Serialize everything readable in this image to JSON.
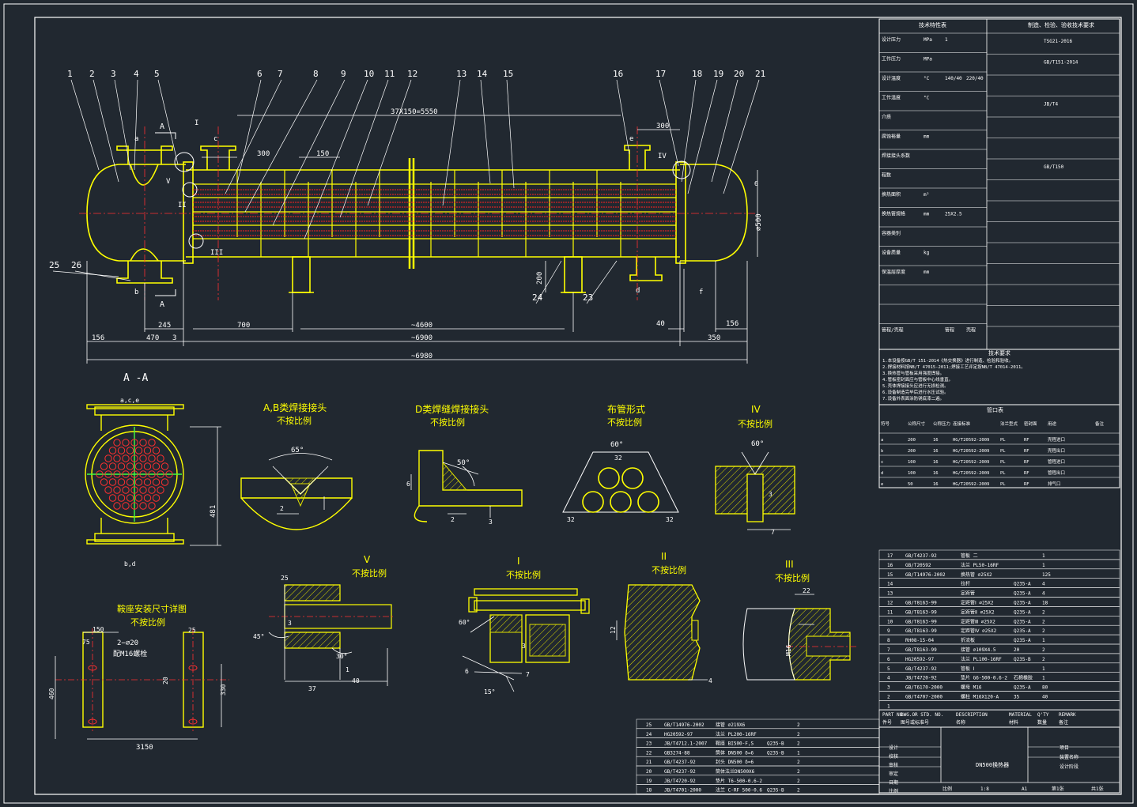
{
  "colors": {
    "background": "#212830",
    "frame": "#ffffff",
    "body": "#ffff00",
    "tube": "#ff2020",
    "hatch": "#e0e000",
    "center": "#ff3030",
    "text": "#ffffff"
  },
  "balloons": [
    "1",
    "2",
    "3",
    "4",
    "5",
    "6",
    "7",
    "8",
    "9",
    "10",
    "11",
    "12",
    "13",
    "14",
    "15",
    "16",
    "17",
    "18",
    "19",
    "20",
    "21",
    "25",
    "26",
    "24",
    "23"
  ],
  "dims": {
    "pitch": "37X150=5550",
    "d300a": "300",
    "d300b": "300",
    "d150": "150",
    "d156a": "156",
    "d470": "470",
    "d3": "3",
    "d245": "245",
    "d700": "700",
    "d4600": "~4600",
    "d40": "40",
    "d156b": "156",
    "d6900": "~6900",
    "d350": "350",
    "d6980": "~6980",
    "d200": "200",
    "d500": "⌀500",
    "d6": "6"
  },
  "nozzles": {
    "a": "a",
    "b": "b",
    "c": "c",
    "d": "d",
    "e": "e",
    "f": "f"
  },
  "markers": {
    "sec_a_top": "A",
    "sec_a_bot": "A",
    "I": "I",
    "II": "II",
    "III": "III",
    "IV": "IV",
    "V": "V"
  },
  "views": {
    "aa": {
      "title": "A -A",
      "top": "a,c,e",
      "bottom": "b,d",
      "dim481": "481"
    },
    "weld_ab": {
      "title": "A,B类焊接接头",
      "note": "不按比例",
      "angle": "65°",
      "d2": "2"
    },
    "weld_d": {
      "title": "D类焊缝焊接接头",
      "note": "不按比例",
      "angle": "50°",
      "d6": "6",
      "d2": "2",
      "d3": "3"
    },
    "tube_layout": {
      "title": "布管形式",
      "note": "不按比例",
      "angle": "60°",
      "d32a": "32",
      "d32b": "32",
      "d32c": "32"
    },
    "iv": {
      "title": "IV",
      "note": "不按比例",
      "angle": "60°",
      "d3": "3",
      "d7": "7"
    },
    "saddle": {
      "title": "鞍座安装尺寸详图",
      "note": "不按比例",
      "d150": "150",
      "d75": "75",
      "d2phi20": "2−⌀20",
      "bolt": "配M16螺栓",
      "d460": "460",
      "d3150": "3150",
      "d25": "25",
      "d20": "20",
      "d330": "330"
    },
    "v": {
      "title": "V",
      "note": "不按比例",
      "d25": "25",
      "d45": "45°",
      "d30": "30°",
      "d37": "37",
      "d40": "40",
      "d1": "1",
      "d3": "3"
    },
    "i": {
      "title": "I",
      "note": "不按比例",
      "d60": "60°",
      "d6": "6",
      "d7": "7",
      "d15": "15°",
      "d3": "3"
    },
    "ii": {
      "title": "II",
      "note": "不按比例",
      "d12": "12",
      "d4": "4"
    },
    "iii": {
      "title": "III",
      "note": "不按比例",
      "d22": "22",
      "dm16": "M16"
    }
  },
  "design_table": {
    "left_head": "技术特性表",
    "right_head": "制造、检验、验收技术要求",
    "rows": [
      [
        "设计压力",
        "MPa",
        "1",
        ""
      ],
      [
        "工作压力",
        "MPa",
        "",
        ""
      ],
      [
        "设计温度",
        "°C",
        "140/40",
        "220/40"
      ],
      [
        "工作温度",
        "°C",
        "",
        ""
      ],
      [
        "介质",
        "",
        "",
        ""
      ],
      [
        "腐蚀裕量",
        "mm",
        "",
        ""
      ],
      [
        "焊接接头系数",
        "",
        "",
        ""
      ],
      [
        "程数",
        "",
        "",
        ""
      ],
      [
        "换热面积",
        "m²",
        "",
        ""
      ],
      [
        "换热管规格",
        "mm",
        "25X2.5",
        ""
      ],
      [
        "容器类别",
        "",
        "",
        ""
      ],
      [
        "设备质量",
        "kg",
        "",
        ""
      ],
      [
        "保温层厚度",
        "mm",
        "",
        ""
      ],
      [
        "",
        "",
        "",
        ""
      ],
      [
        "",
        "",
        "",
        ""
      ],
      [
        "管程/壳程",
        "",
        "管程",
        "壳程"
      ]
    ],
    "right_rows": [
      "TSG21-2016",
      "GB/T151-2014",
      "",
      "JB/T4",
      "",
      "",
      "GB/T150",
      "",
      "",
      "",
      "",
      "",
      "",
      "",
      ""
    ],
    "notes_title": "技术要求",
    "notes": [
      "1.本设备按GB/T 151-2014《热交换器》进行制造、检验和验收。",
      "2.焊接材料按NB/T 47015-2011;焊接工艺评定按NB/T 47014-2011。",
      "3.换热管与管板采用强度焊接。",
      "4.管板密封面应与管板中心线垂直。",
      "5.壳体焊接接头应进行无损检测。",
      "6.设备制造完毕后进行水压试验。",
      "7.设备外表面涂防锈底漆二遍。"
    ],
    "nozzle_title": "管口表",
    "nozzle_cols": [
      "符号",
      "公称尺寸",
      "公称压力",
      "连接标准",
      "法兰型式",
      "密封面",
      "用途",
      "备注"
    ],
    "nozzle_rows": [
      [
        "a",
        "200",
        "16",
        "HG/T20592-2009",
        "PL",
        "RF",
        "壳程进口",
        ""
      ],
      [
        "b",
        "200",
        "16",
        "HG/T20592-2009",
        "PL",
        "RF",
        "壳程出口",
        ""
      ],
      [
        "c",
        "100",
        "16",
        "HG/T20592-2009",
        "PL",
        "RF",
        "管程进口",
        ""
      ],
      [
        "d",
        "100",
        "16",
        "HG/T20592-2009",
        "PL",
        "RF",
        "管程出口",
        ""
      ],
      [
        "e",
        "50",
        "16",
        "HG/T20592-2009",
        "PL",
        "RF",
        "排气口",
        ""
      ]
    ]
  },
  "parts_right": [
    [
      "17",
      "GB/T4237-92",
      "管板 二",
      "",
      "1",
      ""
    ],
    [
      "16",
      "GB/T20592",
      "法兰 PL50-16RF",
      "",
      "1",
      ""
    ],
    [
      "15",
      "GB/T14976-2002",
      "换热管 ⌀25X2",
      "",
      "125",
      ""
    ],
    [
      "14",
      "",
      "拉杆",
      "Q235-A",
      "4",
      ""
    ],
    [
      "13",
      "",
      "定距管",
      "Q235-A",
      "4",
      ""
    ],
    [
      "12",
      "GB/T8163-99",
      "定距管Ⅰ ⌀25X2",
      "Q235-A",
      "18",
      ""
    ],
    [
      "11",
      "GB/T8163-99",
      "定距管Ⅱ ⌀25X2",
      "Q235-A",
      "2",
      ""
    ],
    [
      "10",
      "GB/T8163-99",
      "定距管Ⅲ ⌀25X2",
      "Q235-A",
      "2",
      ""
    ],
    [
      "9",
      "GB/T8163-99",
      "定距管Ⅳ ⌀25X2",
      "Q235-A",
      "2",
      ""
    ],
    [
      "8",
      "RH08-15-04",
      "折流板",
      "Q235-A",
      "1",
      ""
    ],
    [
      "7",
      "GB/T8163-99",
      "接管 ⌀109X4.5",
      "20",
      "2",
      ""
    ],
    [
      "6",
      "HG20592-97",
      "法兰 PL100-16RF",
      "Q235-B",
      "2",
      ""
    ],
    [
      "5",
      "GB/T4237-92",
      "管板 Ⅰ",
      "",
      "1",
      ""
    ],
    [
      "4",
      "JB/T4720-92",
      "垫片 G6-500-0.6-2",
      "石棉橡胶",
      "1",
      ""
    ],
    [
      "3",
      "GB/T6170-2000",
      "螺母 M16",
      "Q235-A",
      "80",
      ""
    ],
    [
      "2",
      "GB/T4707-2000",
      "螺柱 M16X120-A",
      "35",
      "40",
      ""
    ],
    [
      "1",
      "",
      "",
      "",
      "",
      ""
    ]
  ],
  "parts_header": [
    "PART NO.",
    "DWG.OR STD. NO.",
    "DESCRIPTION",
    "MATERIAL",
    "Q'TY",
    "REMARK"
  ],
  "parts_header_cn": [
    "件号",
    "图号或标准号",
    "名称",
    "材料",
    "数量",
    "备注"
  ],
  "parts_bottom": [
    [
      "25",
      "GB/T14976-2002",
      "接管 ⌀219X6",
      "",
      "2",
      ""
    ],
    [
      "24",
      "HG20592-97",
      "法兰 PL200-16RF",
      "",
      "2",
      ""
    ],
    [
      "23",
      "JB/T4712.1-2007",
      "鞍座 BI500-F,S",
      "Q235-B",
      "2",
      ""
    ],
    [
      "22",
      "GB3274-88",
      "筒体 DN500 δ=6",
      "Q235-B",
      "1",
      ""
    ],
    [
      "21",
      "GB/T4237-92",
      "封头 DN500 δ=6",
      "",
      "2",
      ""
    ],
    [
      "20",
      "GB/T4237-92",
      "筒体法兰DN500X6",
      "",
      "2",
      ""
    ],
    [
      "19",
      "JB/T4720-92",
      "垫片 T6-500-0.6-2",
      "",
      "2",
      ""
    ],
    [
      "18",
      "JB/T4701-2000",
      "法兰 C-RF 500-0.6",
      "Q235-B",
      "2",
      ""
    ]
  ],
  "title_block": {
    "name": "DN500换热器",
    "left_labels": [
      "设计",
      "校核",
      "审核",
      "审定",
      "日期",
      "比例"
    ],
    "right_labels": [
      "项目",
      "装置名称",
      "设计阶段"
    ],
    "scale": "比例",
    "scale_value": "1:8",
    "sheet": "A1",
    "sheets": "第1张",
    "total": "共1张"
  }
}
